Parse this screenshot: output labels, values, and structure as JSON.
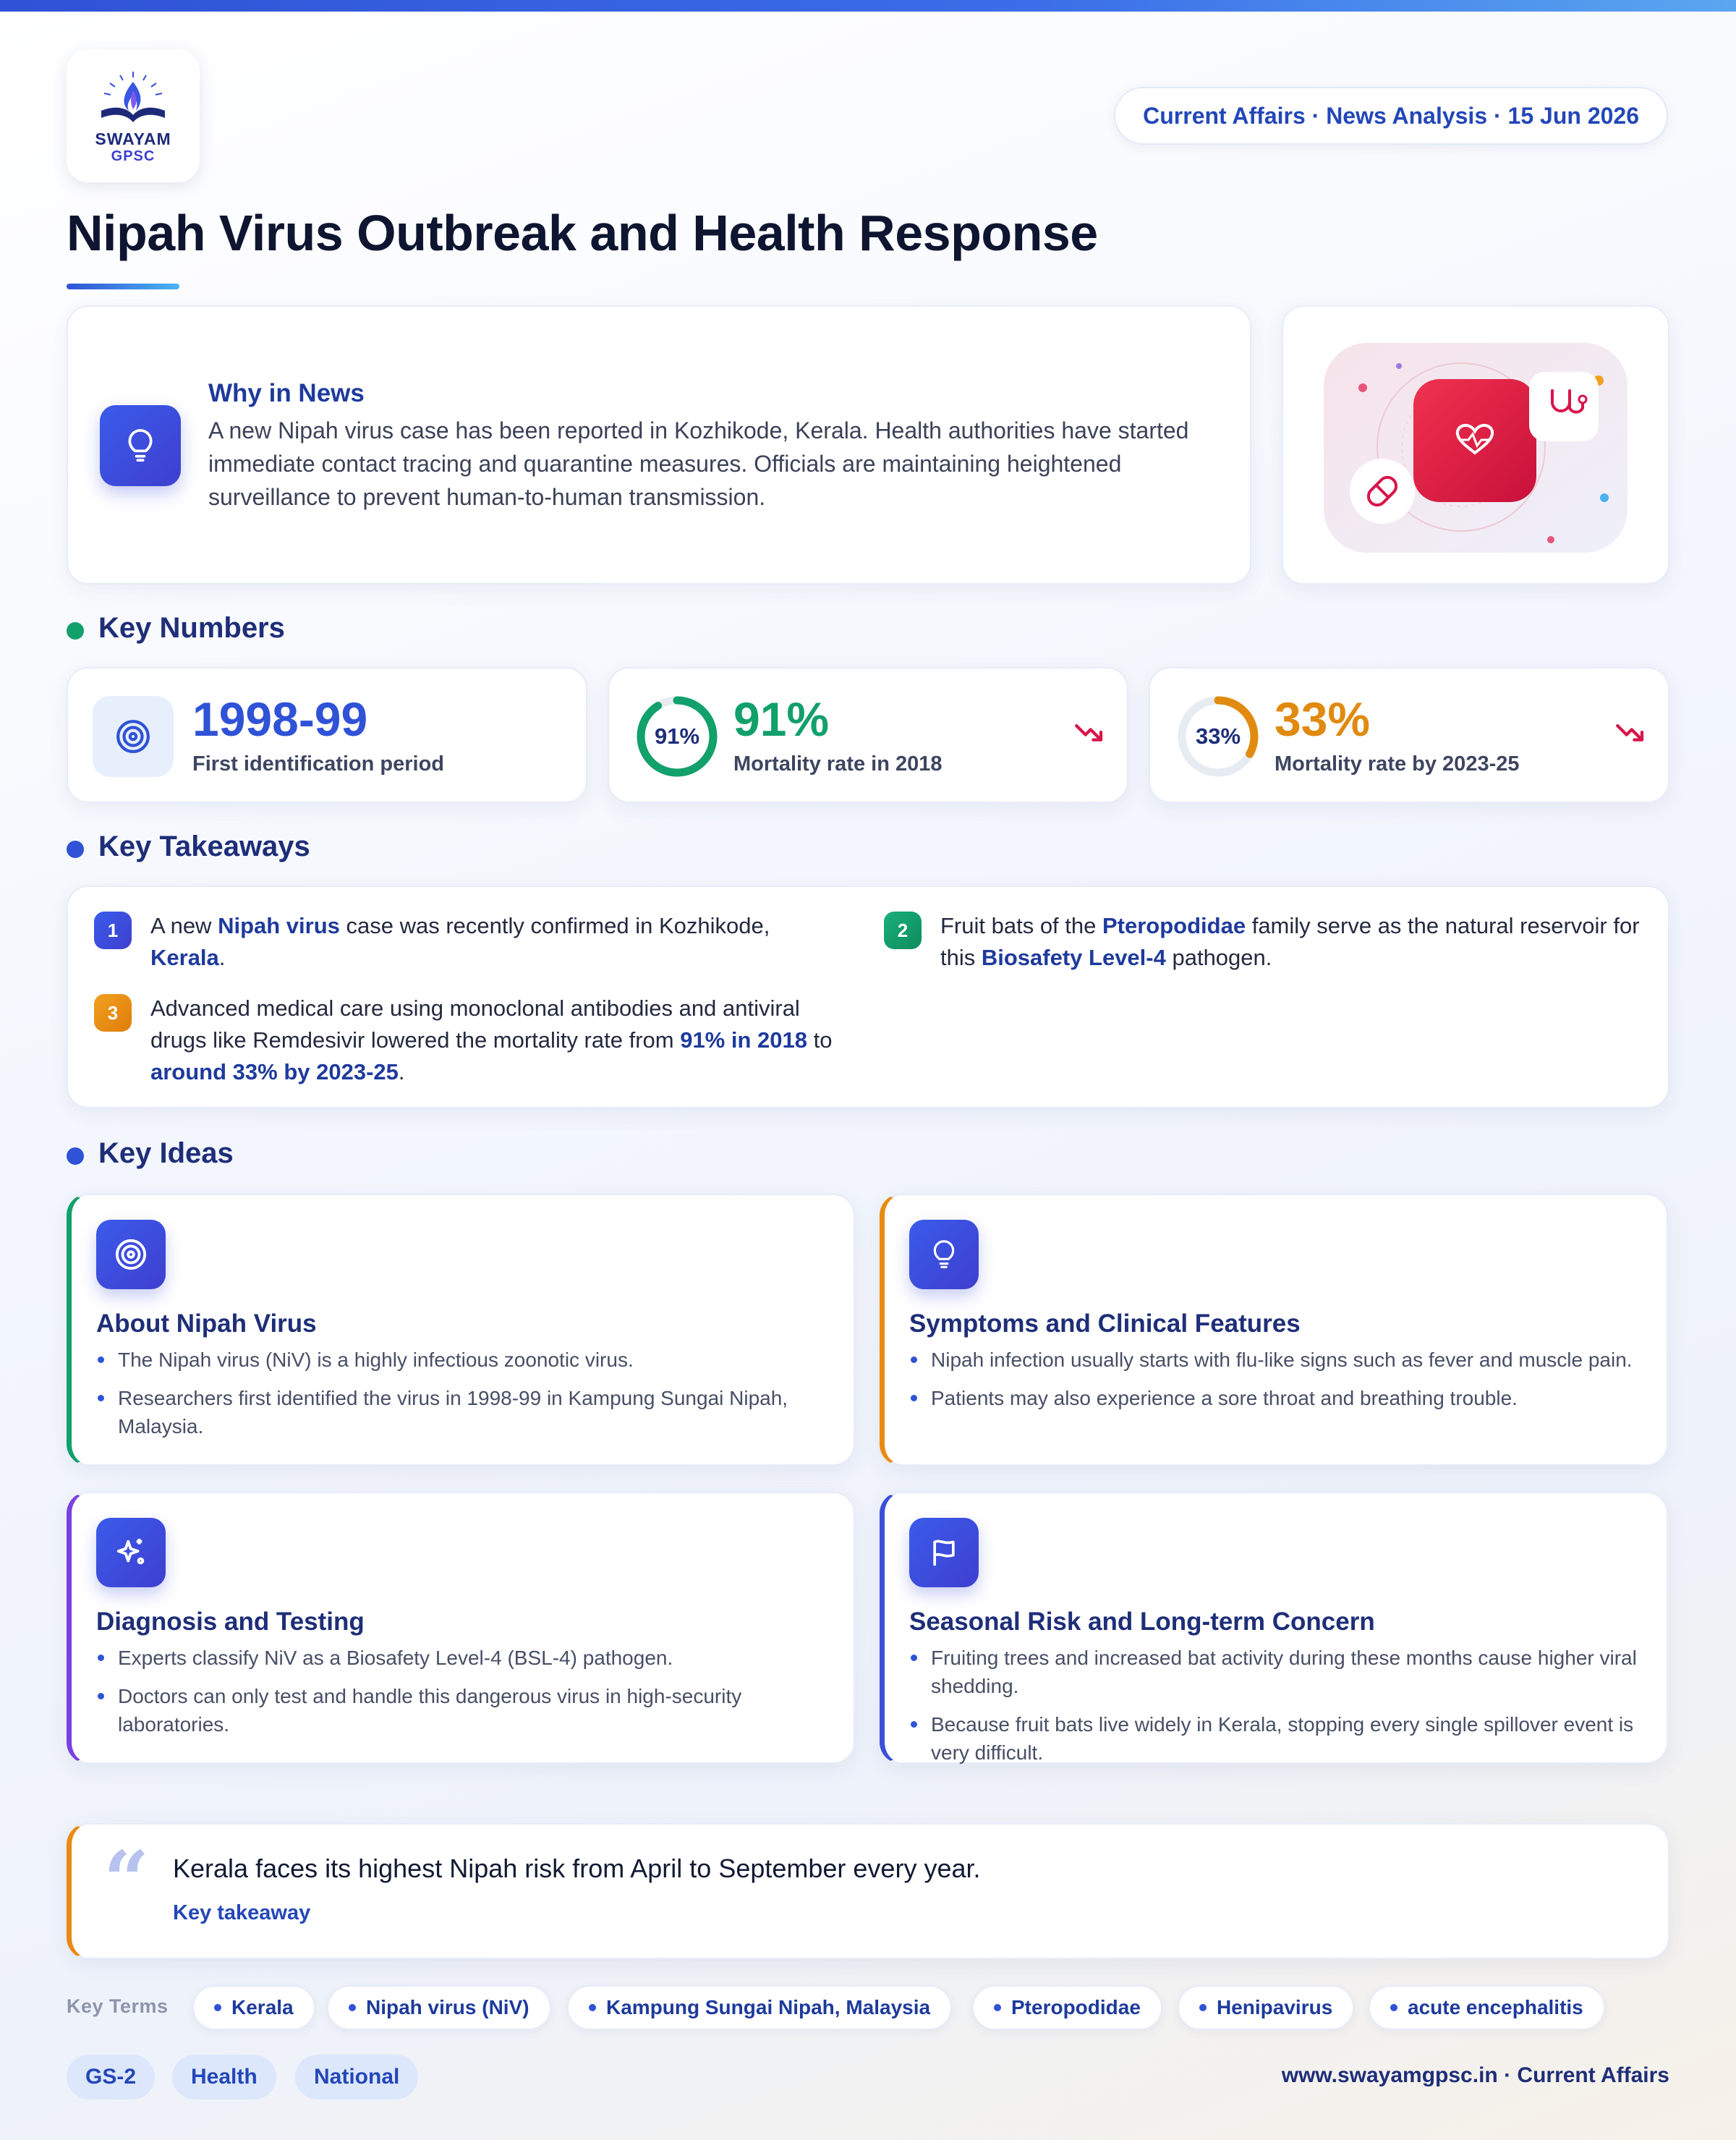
{
  "brand": {
    "line1": "SWAYAM",
    "line2": "GPSC"
  },
  "meta": "Current Affairs · News Analysis · 15 Jun 2026",
  "title": "Nipah Virus Outbreak and Health Response",
  "why_in_news": {
    "heading": "Why in News",
    "text": "A new Nipah virus case has been reported in Kozhikode, Kerala. Health authorities have started immediate contact tracing and quarantine measures. Officials are maintaining heightened surveillance to prevent human-to-human transmission."
  },
  "sections": {
    "key_numbers": "Key Numbers",
    "key_takeaways": "Key Takeaways",
    "key_ideas": "Key Ideas"
  },
  "stats": [
    {
      "value": "1998-99",
      "label": "First identification period",
      "icon": "target-icon",
      "color": "#2f52d6"
    },
    {
      "value": "91%",
      "label": "Mortality rate in 2018",
      "ring_text": "91%",
      "ring_fraction": 0.91,
      "color": "#12a06b"
    },
    {
      "value": "33%",
      "label": "Mortality rate by 2023-25",
      "ring_text": "33%",
      "ring_fraction": 0.33,
      "color": "#e08a10"
    }
  ],
  "takeaways": [
    {
      "n": "1",
      "pre": "A new ",
      "b1": "Nipah virus",
      "mid": " case was recently confirmed in Kozhikode, ",
      "b2": "Kerala",
      "post": "."
    },
    {
      "n": "2",
      "pre": "Fruit bats of the ",
      "b1": "Pteropodidae",
      "mid": " family serve as the natural reservoir for this ",
      "b2": "Biosafety Level-4",
      "post": " pathogen."
    },
    {
      "n": "3",
      "pre": "Advanced medical care using monoclonal antibodies and antiviral drugs like Remdesivir lowered the mortality rate from ",
      "b1": "91% in 2018",
      "mid": " to ",
      "b2": "around 33% by 2023-25",
      "post": "."
    }
  ],
  "ideas": [
    {
      "title": "About Nipah Virus",
      "icon": "target-icon",
      "accent": "#12a06b",
      "points": [
        "The Nipah virus (NiV) is a highly infectious zoonotic virus.",
        "Researchers first identified the virus in 1998-99 in Kampung Sungai Nipah, Malaysia."
      ]
    },
    {
      "title": "Symptoms and Clinical Features",
      "icon": "lightbulb-icon",
      "accent": "#e98a12",
      "points": [
        "Nipah infection usually starts with flu-like signs such as fever and muscle pain.",
        "Patients may also experience a sore throat and breathing trouble."
      ]
    },
    {
      "title": "Diagnosis and Testing",
      "icon": "sparkles-icon",
      "accent": "#7b3fe0",
      "points": [
        "Experts classify NiV as a Biosafety Level-4 (BSL-4) pathogen.",
        "Doctors can only test and handle this dangerous virus in high-security laboratories."
      ]
    },
    {
      "title": "Seasonal Risk and Long-term Concern",
      "icon": "flag-icon",
      "accent": "#3a4fd8",
      "points": [
        "Fruiting trees and increased bat activity during these months cause higher viral shedding.",
        "Because fruit bats live widely in Kerala, stopping every single spillover event is very difficult."
      ]
    }
  ],
  "quote": {
    "text": "Kerala faces its highest Nipah risk from April to September every year.",
    "caption": "Key takeaway"
  },
  "key_terms": {
    "label": "Key Terms",
    "items": [
      "Kerala",
      "Nipah virus (NiV)",
      "Kampung Sungai Nipah, Malaysia",
      "Pteropodidae",
      "Henipavirus",
      "acute encephalitis"
    ]
  },
  "tags": [
    "GS-2",
    "Health",
    "National"
  ],
  "footer": "www.swayamgpsc.in · Current Affairs"
}
